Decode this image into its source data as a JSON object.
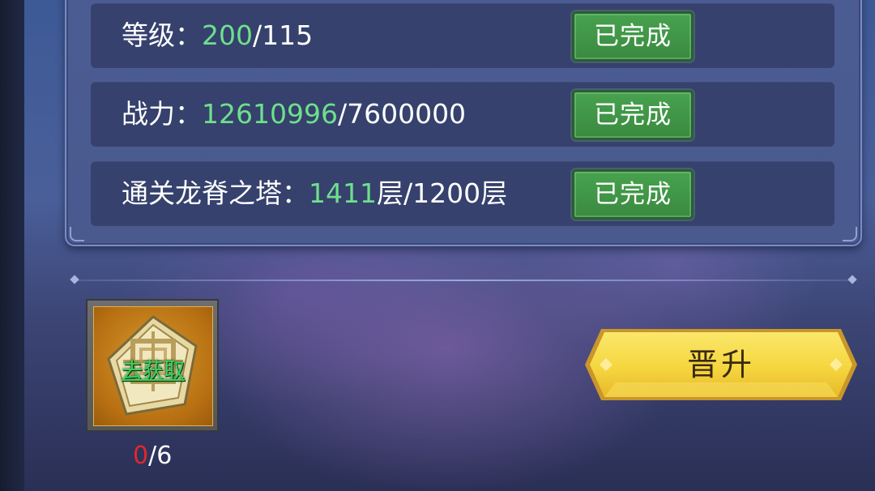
{
  "requirements": [
    {
      "label": "等级：",
      "current": "200",
      "suffix": "/115",
      "status": "已完成"
    },
    {
      "label": "战力：",
      "current": "12610996",
      "suffix": "/7600000",
      "status": "已完成"
    },
    {
      "label": "通关龙脊之塔：",
      "current": "1411",
      "suffix": "层/1200层",
      "status": "已完成"
    }
  ],
  "item": {
    "get_label": "去获取",
    "count_current": "0",
    "count_total": "/6"
  },
  "promote_button": {
    "label": "晋升"
  },
  "colors": {
    "highlight": "#6de08d",
    "done_badge": "#47a24f",
    "count_current": "#e0282a",
    "promote_button": "#f5d63f"
  }
}
